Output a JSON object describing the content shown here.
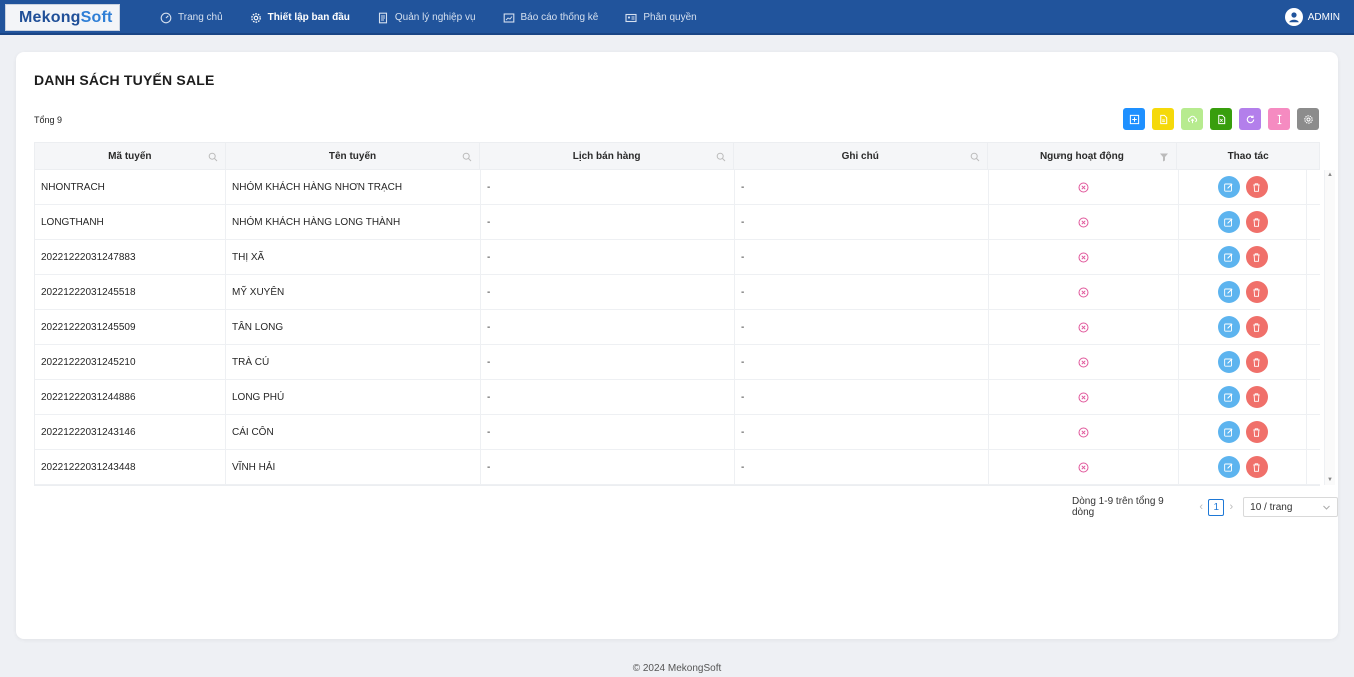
{
  "brand": {
    "part1": "Mekong",
    "part2": "Soft"
  },
  "nav": [
    {
      "label": "Trang chủ",
      "icon": "dashboard-icon",
      "active": false
    },
    {
      "label": "Thiết lập ban đầu",
      "icon": "gear-icon",
      "active": true
    },
    {
      "label": "Quản lý nghiệp vụ",
      "icon": "document-icon",
      "active": false
    },
    {
      "label": "Báo cáo thống kê",
      "icon": "report-icon",
      "active": false
    },
    {
      "label": "Phân quyền",
      "icon": "id-card-icon",
      "active": false
    }
  ],
  "user": {
    "name": "ADMIN"
  },
  "page": {
    "title": "DANH SÁCH TUYẾN SALE",
    "total": "Tổng 9"
  },
  "toolbar": [
    {
      "name": "add",
      "icon": "plus-square-icon",
      "color": "#1e90ff"
    },
    {
      "name": "export",
      "icon": "file-icon",
      "color": "#f5d90a"
    },
    {
      "name": "upload",
      "icon": "cloud-upload-icon",
      "color": "#b7eb8f"
    },
    {
      "name": "excel",
      "icon": "excel-icon",
      "color": "#389e0d"
    },
    {
      "name": "reload",
      "icon": "reload-icon",
      "color": "#b37feb"
    },
    {
      "name": "column-width",
      "icon": "column-width-icon",
      "color": "#f58bc1"
    },
    {
      "name": "settings",
      "icon": "settings-icon",
      "color": "#8c8c8c"
    }
  ],
  "table": {
    "headers": [
      "Mã tuyến",
      "Tên tuyến",
      "Lịch bán hàng",
      "Ghi chú",
      "Ngưng hoạt động",
      "Thao tác"
    ],
    "rows": [
      {
        "code": "NHONTRACH",
        "name": "NHÓM KHÁCH HÀNG NHƠN TRẠCH",
        "schedule": "-",
        "note": "-"
      },
      {
        "code": "LONGTHANH",
        "name": "NHÓM KHÁCH HÀNG LONG THÀNH",
        "schedule": "-",
        "note": "-"
      },
      {
        "code": "20221222031247883",
        "name": "THỊ XÃ",
        "schedule": "-",
        "note": "-"
      },
      {
        "code": "20221222031245518",
        "name": "MỸ XUYÊN",
        "schedule": "-",
        "note": "-"
      },
      {
        "code": "20221222031245509",
        "name": "TÂN LONG",
        "schedule": "-",
        "note": "-"
      },
      {
        "code": "20221222031245210",
        "name": "TRÀ CÚ",
        "schedule": "-",
        "note": "-"
      },
      {
        "code": "20221222031244886",
        "name": "LONG PHÚ",
        "schedule": "-",
        "note": "-"
      },
      {
        "code": "20221222031243146",
        "name": "CÁI CÔN",
        "schedule": "-",
        "note": "-"
      },
      {
        "code": "20221222031243448",
        "name": "VĨNH HẢI",
        "schedule": "-",
        "note": "-"
      }
    ]
  },
  "pagination": {
    "info": "Dòng 1-9 trên tổng 9 dòng",
    "current": "1",
    "page_size": "10 / trang"
  },
  "footer": "© 2024 MekongSoft",
  "colors": {
    "nav_bg": "#21549c",
    "edit": "#5db4ef",
    "delete": "#f0706a",
    "inactive_icon": "#e0559a"
  }
}
